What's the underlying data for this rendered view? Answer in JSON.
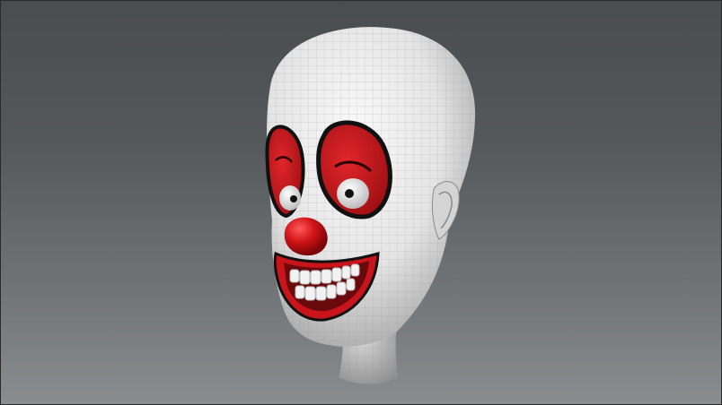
{
  "scene": {
    "subject_icon": "clown-head-3d-model-icon",
    "colors": {
      "bg_top": "#4a4d50",
      "bg_bottom": "#8a8c8e",
      "skin": "#e6e6e6",
      "paint_red": "#c8141a",
      "outline": "#111111",
      "teeth": "#f2f2f2",
      "wireframe": "#9a9a9a"
    }
  }
}
